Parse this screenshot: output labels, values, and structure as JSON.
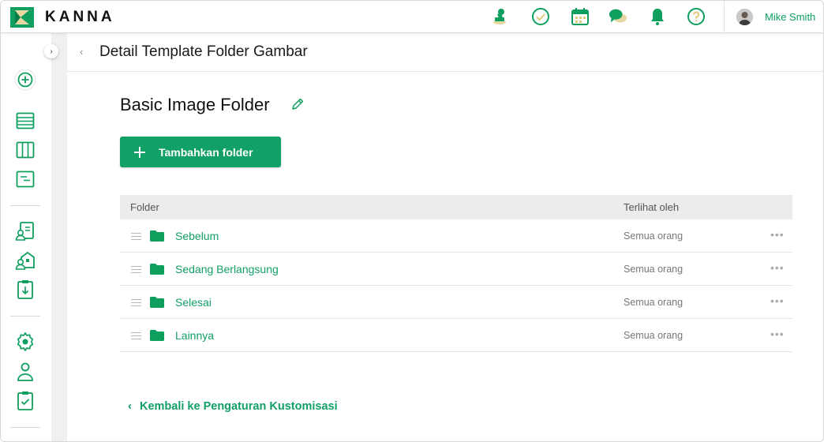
{
  "brand": {
    "name": "KANNA",
    "accent": "#11a065"
  },
  "topbar": {
    "icons": [
      "stamp-icon",
      "check-circle-icon",
      "calendar-icon",
      "chat-icon",
      "bell-icon",
      "help-icon"
    ],
    "user_name": "Mike Smith"
  },
  "sidebar": {
    "collapse_glyph": "›",
    "items": [
      "add-circle-icon",
      "list-icon",
      "board-icon",
      "table-icon",
      "contacts-icon",
      "building-user-icon",
      "clipboard-download-icon",
      "settings-icon",
      "user-icon",
      "clipboard-check-icon"
    ]
  },
  "header": {
    "back_glyph": "‹",
    "title": "Detail Template Folder Gambar"
  },
  "main": {
    "folder_title": "Basic Image Folder",
    "add_button_label": "Tambahkan folder",
    "table": {
      "columns": [
        "Folder",
        "Terlihat oleh"
      ],
      "rows": [
        {
          "name": "Sebelum",
          "visibility": "Semua orang"
        },
        {
          "name": "Sedang Berlangsung",
          "visibility": "Semua orang"
        },
        {
          "name": "Selesai",
          "visibility": "Semua orang"
        },
        {
          "name": "Lainnya",
          "visibility": "Semua orang"
        }
      ],
      "more_glyph": "•••"
    },
    "back_link": {
      "glyph": "‹",
      "label": "Kembali ke Pengaturan Kustomisasi"
    }
  }
}
